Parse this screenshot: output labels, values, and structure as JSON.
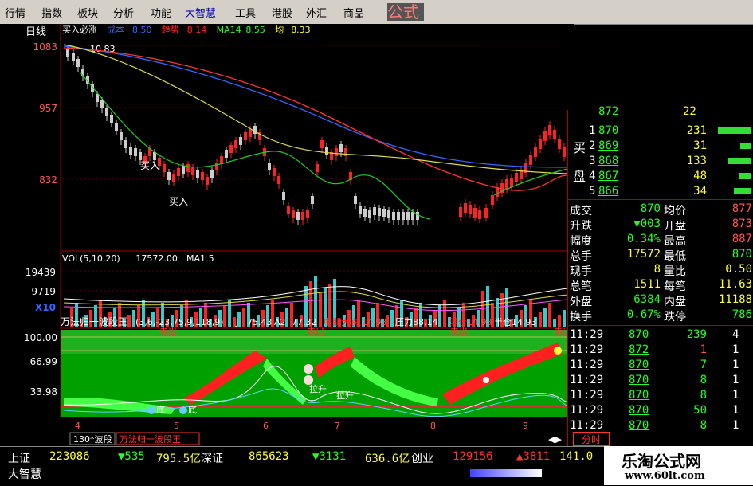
{
  "menu": [
    "行情",
    "指数",
    "板块",
    "分析",
    "功能",
    "大智慧",
    "工具",
    "港股",
    "外汇",
    "商品"
  ],
  "formula_title": "公式",
  "price_panel": {
    "period": "日线",
    "legend": [
      {
        "label": "买入必涨",
        "color": "#ffffff"
      },
      {
        "label": "成本",
        "color": "#3366ff"
      },
      {
        "label": "8.50",
        "color": "#3366ff"
      },
      {
        "label": "趋势",
        "color": "#ff2222"
      },
      {
        "label": "8.14",
        "color": "#ff2222"
      },
      {
        "label": "MA14",
        "color": "#22ff22"
      },
      {
        "label": "8.55",
        "color": "#22ff22"
      },
      {
        "label": "均",
        "color": "#ffff33"
      },
      {
        "label": "8.33",
        "color": "#ffff33"
      }
    ],
    "y_labels": [
      "1083",
      "957",
      "832"
    ],
    "high_label": "10.83",
    "buy_labels": [
      "买入",
      "买入"
    ]
  },
  "volume_panel": {
    "legend": [
      "VOL(5,10,20)",
      "17572.00",
      "MA1",
      "5"
    ],
    "y_labels": [
      "19439",
      "9719",
      "X10"
    ]
  },
  "indicator_panel": {
    "title": "万法归一波段王",
    "params": "(3,6,-23,75,9,118,9)",
    "values": [
      {
        "label": "J",
        "value": "75.43",
        "color": "#ffffff"
      },
      {
        "label": "A2",
        "value": "77.32",
        "color": "#ffffff"
      },
      {
        "label": "中期大底",
        "value": "14.93",
        "color": "#ff2222"
      },
      {
        "label": "压力",
        "value": "88.14",
        "color": "#ffffff"
      },
      {
        "label": "满仓",
        "value": "14.93",
        "color": "#ff2222"
      },
      {
        "label": "半仓",
        "value": "14.93",
        "color": "#ffffff"
      }
    ],
    "y_labels": [
      "100.00",
      "66.99",
      "33.98"
    ],
    "signal_labels": [
      "卖出",
      "卖出",
      "卖出",
      "卖出",
      "拉升",
      "拉升",
      "底",
      "底"
    ]
  },
  "x_axis": [
    "4",
    "5",
    "6",
    "7",
    "8",
    "9"
  ],
  "bottom_tabs": [
    "130*波段",
    "万法归一波段王"
  ],
  "order_book": {
    "top_row": {
      "price": "872",
      "vol": "22"
    },
    "buy_label": [
      "买",
      "盘"
    ],
    "rows": [
      {
        "level": "1",
        "price": "870",
        "vol": "231"
      },
      {
        "level": "2",
        "price": "869",
        "vol": "31"
      },
      {
        "level": "3",
        "price": "868",
        "vol": "133"
      },
      {
        "level": "4",
        "price": "867",
        "vol": "48"
      },
      {
        "level": "5",
        "price": "866",
        "vol": "34"
      }
    ]
  },
  "stats": [
    {
      "l1": "成交",
      "v1": "870",
      "l2": "均价",
      "v2": "877"
    },
    {
      "l1": "升跌",
      "v1": "▼003",
      "l2": "开盘",
      "v2": "873"
    },
    {
      "l1": "幅度",
      "v1": "0.34%",
      "l2": "最高",
      "v2": "887"
    },
    {
      "l1": "总手",
      "v1": "17572",
      "l2": "最低",
      "v2": "870"
    },
    {
      "l1": "现手",
      "v1": "8",
      "l2": "量比",
      "v2": "0.50"
    },
    {
      "l1": "总笔",
      "v1": "1511",
      "l2": "每笔",
      "v2": "11.63"
    },
    {
      "l1": "外盘",
      "v1": "6384",
      "l2": "内盘",
      "v2": "11188"
    },
    {
      "l1": "换手",
      "v1": "0.67%",
      "l2": "跌停",
      "v2": "786"
    }
  ],
  "ticks": [
    {
      "time": "11:29",
      "price": "870",
      "vol": "239",
      "side": "4"
    },
    {
      "time": "11:29",
      "price": "872",
      "vol": "1",
      "side": "1"
    },
    {
      "time": "11:29",
      "price": "870",
      "vol": "7",
      "side": "1"
    },
    {
      "time": "11:29",
      "price": "870",
      "vol": "8",
      "side": "1"
    },
    {
      "time": "11:29",
      "price": "870",
      "vol": "8",
      "side": "1"
    },
    {
      "time": "11:29",
      "price": "870",
      "vol": "50",
      "side": "1"
    },
    {
      "time": "11:29",
      "price": "870",
      "vol": "8",
      "side": "1"
    }
  ],
  "right_tab": "分时",
  "status": {
    "row1": [
      {
        "text": "上证",
        "color": "#ffffff"
      },
      {
        "text": "223086",
        "color": "#ffff33"
      },
      {
        "text": "▼535",
        "color": "#22ff22"
      },
      {
        "text": "795.5亿",
        "color": "#ffff33"
      },
      {
        "text": "深证",
        "color": "#ffffff"
      },
      {
        "text": "865623",
        "color": "#ffff33"
      },
      {
        "text": "▼3131",
        "color": "#22ff22"
      },
      {
        "text": "636.6亿",
        "color": "#ffff33"
      },
      {
        "text": "创业",
        "color": "#ffffff"
      },
      {
        "text": "129156",
        "color": "#ff3333"
      },
      {
        "text": "▲3811",
        "color": "#ff3333"
      },
      {
        "text": "141.0",
        "color": "#ffff33"
      }
    ],
    "row2": "大智慧"
  },
  "watermark": {
    "title": "乐淘公式网",
    "url": "www.60lt.com"
  }
}
